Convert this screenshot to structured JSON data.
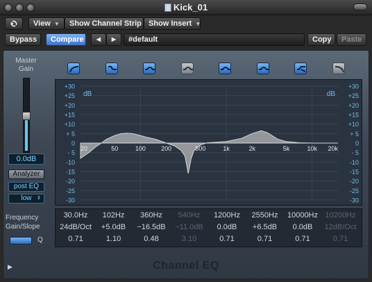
{
  "window": {
    "title": "Kick_01"
  },
  "toolbar": {
    "view_label": "View",
    "channel_strip_label": "Show Channel Strip",
    "insert_label": "Show Insert",
    "bypass_label": "Bypass",
    "compare_label": "Compare",
    "prev_label": "◀",
    "next_label": "▶",
    "preset": "#default",
    "copy_label": "Copy",
    "paste_label": "Paste"
  },
  "left_panel": {
    "master_gain_label_1": "Master",
    "master_gain_label_2": "Gain",
    "gain_value": "0.0dB",
    "fader_level": 0.5,
    "analyzer_label": "Analyzer",
    "analyzer_mode": "post EQ",
    "analyzer_resolution": "low"
  },
  "bands": [
    {
      "icon": "low-cut-icon",
      "active": true
    },
    {
      "icon": "low-shelf-icon",
      "active": true
    },
    {
      "icon": "parametric-bell-icon",
      "active": true
    },
    {
      "icon": "parametric-bell-icon",
      "active": false
    },
    {
      "icon": "parametric-bell-icon",
      "active": true
    },
    {
      "icon": "parametric-bell-icon",
      "active": true
    },
    {
      "icon": "high-shelf-icon",
      "active": true
    },
    {
      "icon": "high-cut-icon",
      "active": false
    }
  ],
  "chart_data": {
    "type": "line",
    "xscale": "log",
    "xlim": [
      20,
      20000
    ],
    "ylim": [
      -30,
      30
    ],
    "y_ticks_left": [
      "+30",
      "+25",
      "+20",
      "+15",
      "+10",
      "+ 5",
      "0",
      "- 5",
      "-10",
      "-15",
      "-20",
      "-25",
      "-30"
    ],
    "y_ticks_right": [
      "+30",
      "+25",
      "+20",
      "+15",
      "+10",
      "+ 5",
      "0",
      "- 5",
      "-10",
      "-15",
      "-20",
      "-25",
      "-30"
    ],
    "x_ticks": [
      "20",
      "50",
      "100",
      "200",
      "500",
      "1k",
      "2k",
      "5k",
      "10k",
      "20k"
    ],
    "x_tick_values": [
      20,
      50,
      100,
      200,
      500,
      1000,
      2000,
      5000,
      10000,
      20000
    ],
    "unit_left": "dB",
    "unit_right": "dB",
    "grid": true,
    "series": [
      {
        "x": [
          20,
          25,
          30,
          35,
          40,
          50,
          60,
          70,
          80,
          100,
          120,
          150,
          200,
          250,
          300,
          330,
          360,
          390,
          420,
          500,
          600,
          800,
          1000,
          1500,
          2000,
          2550,
          3000,
          4000,
          5000,
          7000,
          10000,
          15000,
          20000
        ],
        "y": [
          -8,
          -5,
          -2,
          0,
          2,
          4,
          5,
          5.2,
          5,
          4,
          3,
          2,
          0,
          -1.5,
          -4,
          -7,
          -16,
          -8,
          -4,
          -1,
          0.2,
          0.5,
          0.8,
          2.5,
          5,
          6.5,
          5.5,
          2,
          0.8,
          0.2,
          0,
          0,
          0
        ]
      }
    ]
  },
  "parameters": {
    "row_labels": [
      "Frequency",
      "Gain/Slope",
      "Q"
    ],
    "columns": [
      {
        "freq": "30.0Hz",
        "gain": "24dB/Oct",
        "q": "0.71",
        "active": true
      },
      {
        "freq": "102Hz",
        "gain": "+5.0dB",
        "q": "1.10",
        "active": true
      },
      {
        "freq": "360Hz",
        "gain": "−16.5dB",
        "q": "0.48",
        "active": true
      },
      {
        "freq": "540Hz",
        "gain": "−11.0dB",
        "q": "3.10",
        "active": false
      },
      {
        "freq": "1200Hz",
        "gain": "0.0dB",
        "q": "0.71",
        "active": true
      },
      {
        "freq": "2550Hz",
        "gain": "+6.5dB",
        "q": "0.71",
        "active": true
      },
      {
        "freq": "10000Hz",
        "gain": "0.0dB",
        "q": "0.71",
        "active": true
      },
      {
        "freq": "10200Hz",
        "gain": "12dB/Oct",
        "q": "0.71",
        "active": false
      }
    ]
  },
  "footer": {
    "plugin_name": "Channel EQ",
    "expand_icon": "disclosure-triangle-icon"
  },
  "colors": {
    "accent": "#3f73c8",
    "curve_fill": "#a6a9ad",
    "readout": "#7fd2ff"
  }
}
